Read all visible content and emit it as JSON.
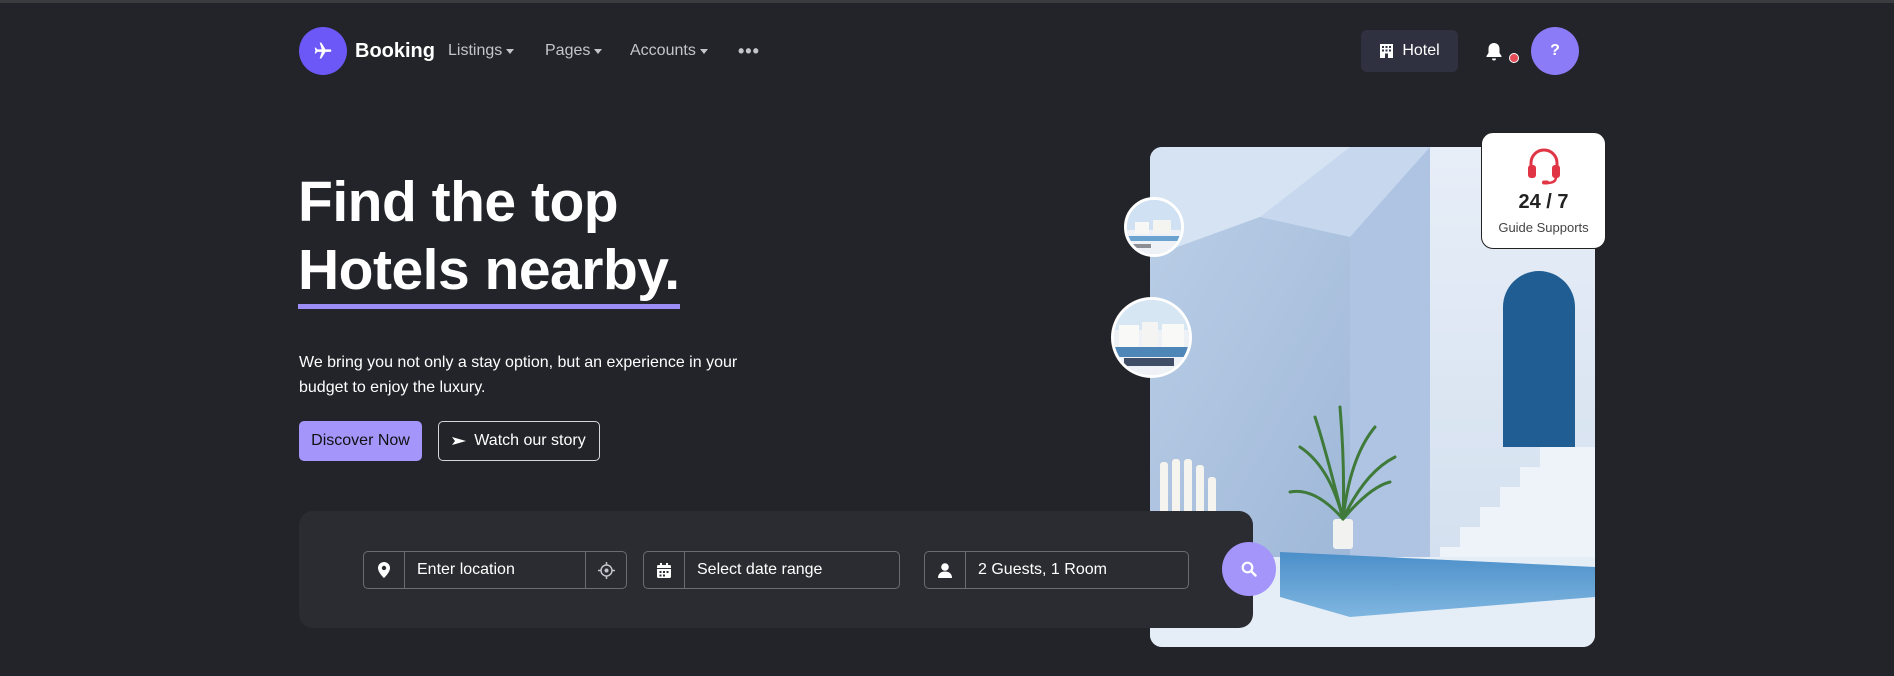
{
  "nav": {
    "brand": "Booking",
    "items": [
      {
        "label": "Listings"
      },
      {
        "label": "Pages"
      },
      {
        "label": "Accounts"
      }
    ],
    "more": "•••",
    "hotel_button": "Hotel",
    "avatar_initial": "?"
  },
  "hero": {
    "title_line1": "Find the top",
    "title_line2": "Hotels nearby.",
    "description": "We bring you not only a stay option, but an experience in your budget to enjoy the luxury.",
    "discover_button": "Discover Now",
    "watch_button": "Watch our story"
  },
  "support": {
    "hours": "24 / 7",
    "label": "Guide Supports"
  },
  "search": {
    "location_placeholder": "Enter location",
    "date_placeholder": "Select date range",
    "guests_value": "2 Guests, 1 Room"
  },
  "colors": {
    "background": "#222429",
    "accent": "#6c57f7",
    "accent_light": "#a395fa",
    "notification": "#e84b58",
    "support_icon": "#e03545"
  },
  "icons": {
    "logo": "plane-icon",
    "hotel": "building-icon",
    "bell": "bell-icon",
    "location": "map-pin-icon",
    "crosshair": "crosshair-icon",
    "calendar": "calendar-icon",
    "user": "user-icon",
    "search": "search-icon",
    "support": "headset-icon",
    "play": "play-icon"
  }
}
